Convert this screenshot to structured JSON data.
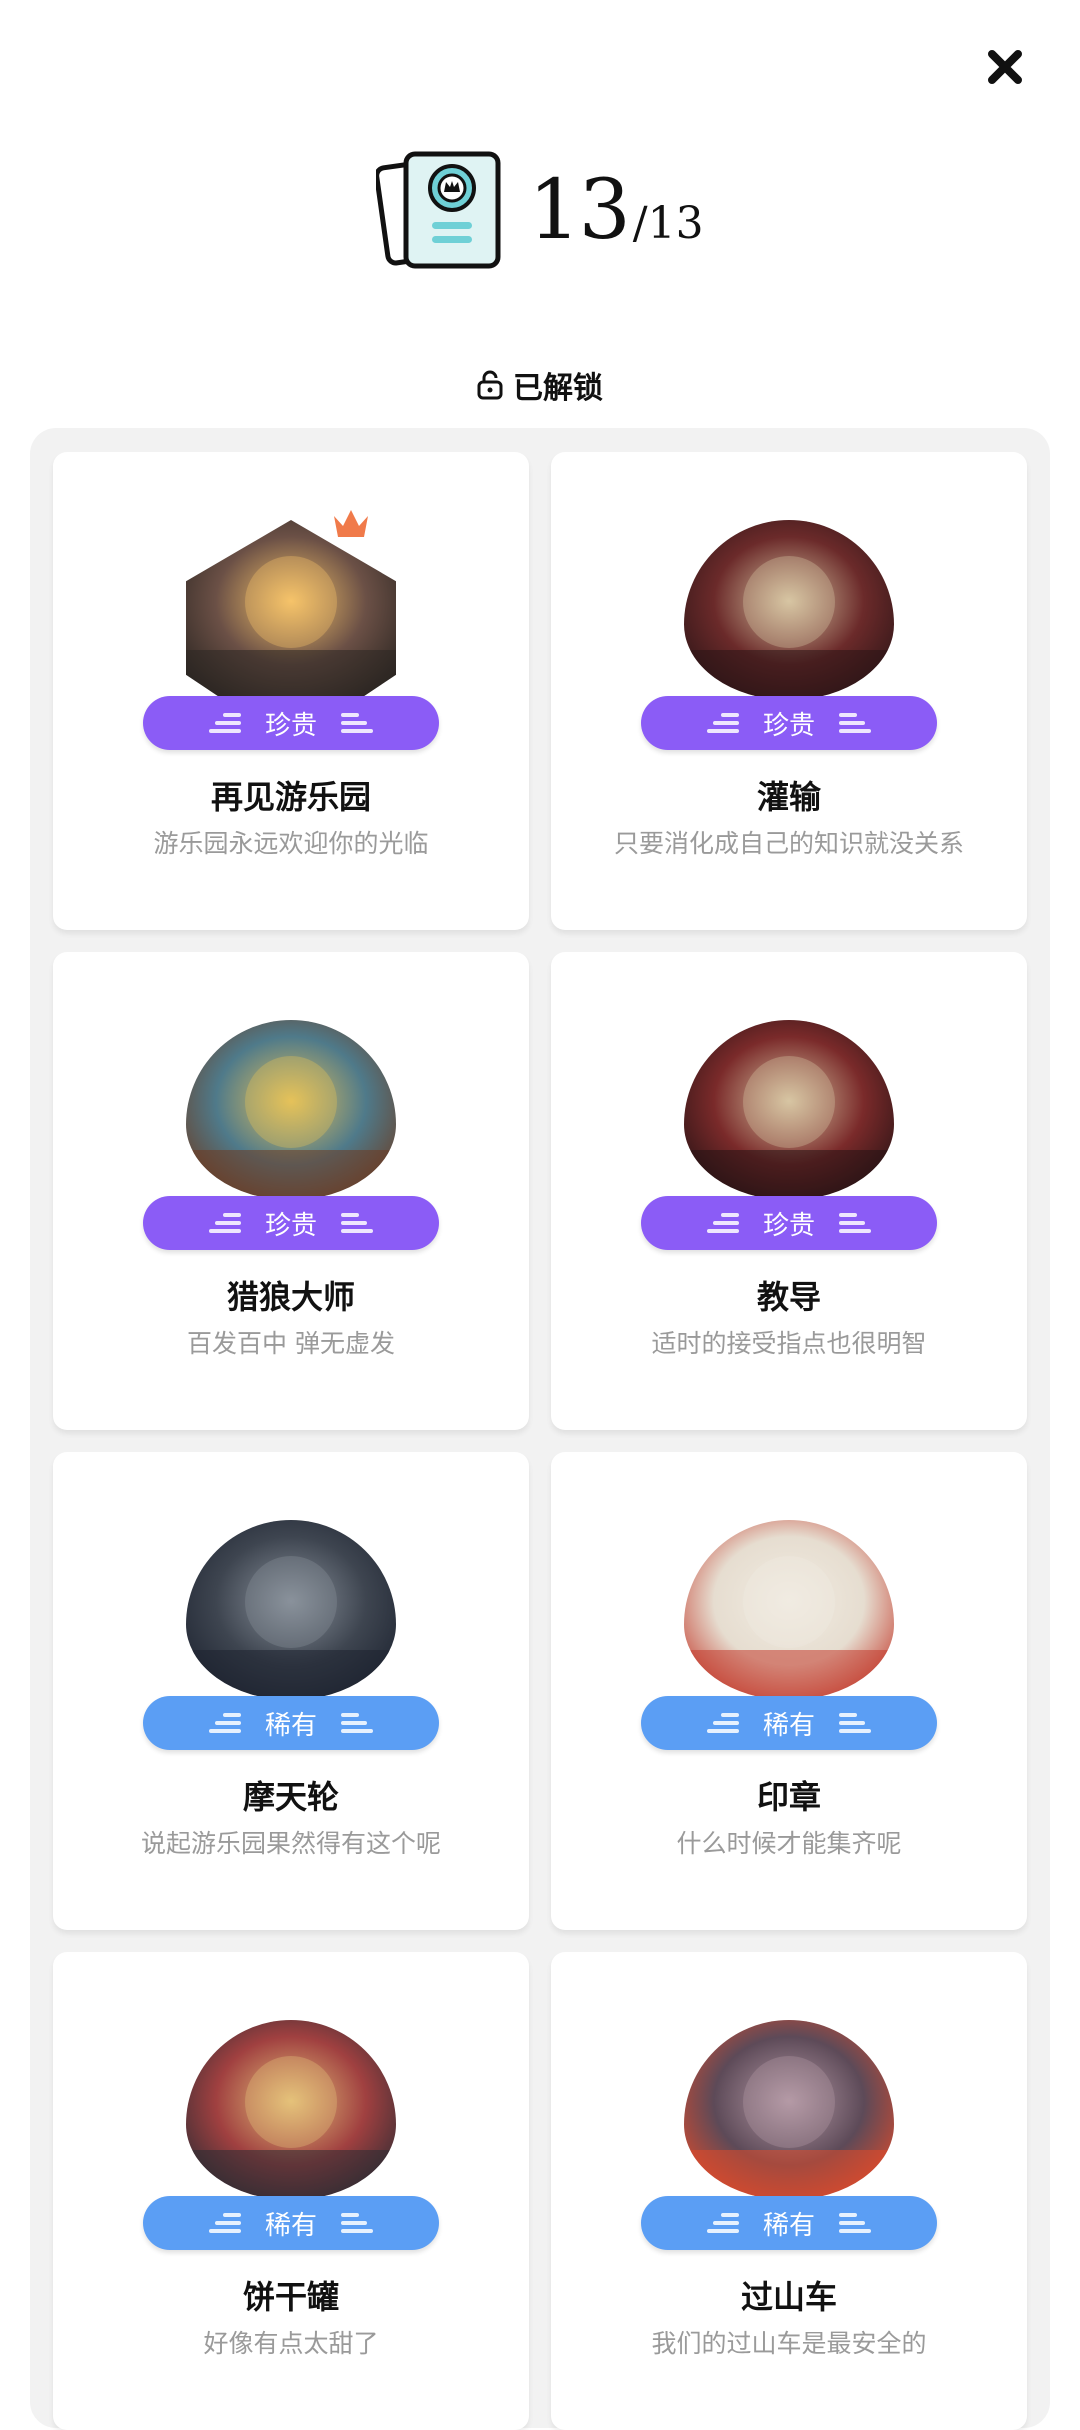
{
  "header": {
    "unlocked_count": "13",
    "total_count": "/13",
    "close_icon": "close-icon",
    "book_icon": "collection-book-icon"
  },
  "section": {
    "label": "已解锁",
    "icon": "unlock-icon"
  },
  "cards": [
    {
      "title": "再见游乐园",
      "desc": "游乐园永远欢迎你的光临",
      "badge": "珍贵",
      "rarity": "precious",
      "shape": "hex",
      "crown": true,
      "palette": [
        "#f6c46a",
        "#6b5046",
        "#2c2622"
      ]
    },
    {
      "title": "灌输",
      "desc": "只要消化成自己的知识就没关系",
      "badge": "珍贵",
      "rarity": "precious",
      "shape": "round",
      "crown": false,
      "palette": [
        "#d8c6a3",
        "#6b2a2a",
        "#2a1416"
      ]
    },
    {
      "title": "猎狼大师",
      "desc": "百发百中 弹无虚发",
      "badge": "珍贵",
      "rarity": "precious",
      "shape": "round",
      "crown": false,
      "palette": [
        "#e6c25a",
        "#4f7a8a",
        "#6b3b22"
      ]
    },
    {
      "title": "教导",
      "desc": "适时的接受指点也很明智",
      "badge": "珍贵",
      "rarity": "precious",
      "shape": "round",
      "crown": false,
      "palette": [
        "#d8c6a3",
        "#7a2a2a",
        "#241214"
      ]
    },
    {
      "title": "摩天轮",
      "desc": "说起游乐园果然得有这个呢",
      "badge": "稀有",
      "rarity": "rare",
      "shape": "round",
      "crown": false,
      "palette": [
        "#8a929c",
        "#3e4550",
        "#1d2330"
      ]
    },
    {
      "title": "印章",
      "desc": "什么时候才能集齐呢",
      "badge": "稀有",
      "rarity": "rare",
      "shape": "round",
      "crown": false,
      "palette": [
        "#f1ece2",
        "#e6ddd0",
        "#c33a2c"
      ]
    },
    {
      "title": "饼干罐",
      "desc": "好像有点太甜了",
      "badge": "稀有",
      "rarity": "rare",
      "shape": "round",
      "crown": false,
      "palette": [
        "#e5c27a",
        "#a04040",
        "#2b2b33"
      ]
    },
    {
      "title": "过山车",
      "desc": "我们的过山车是最安全的",
      "badge": "稀有",
      "rarity": "rare",
      "shape": "round",
      "crown": false,
      "palette": [
        "#b59aa6",
        "#5d4a58",
        "#e04a2a"
      ]
    }
  ],
  "colors": {
    "precious": "#8b5cf6",
    "rare": "#5b9ef4",
    "crown": "#f07a4a",
    "panel": "#f2f2f2"
  }
}
